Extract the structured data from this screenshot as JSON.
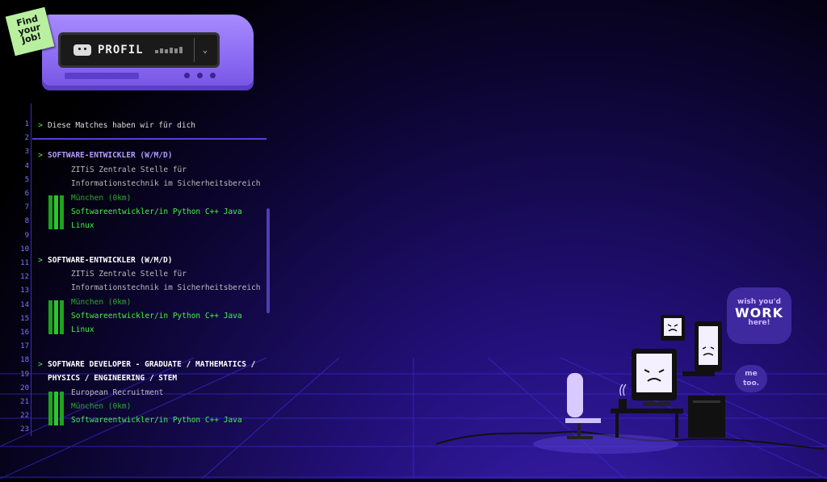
{
  "sticker": {
    "text": "Find your Job!"
  },
  "header": {
    "profile_label": "PROFIL",
    "dropdown_icon": "chevron-down-icon"
  },
  "list": {
    "line_numbers": [
      "1",
      "2",
      "3",
      "4",
      "5",
      "6",
      "7",
      "8",
      "9",
      "10",
      "11",
      "12",
      "13",
      "14",
      "15",
      "16",
      "17",
      "18",
      "19",
      "20",
      "21",
      "22",
      "23"
    ],
    "heading": "Diese Matches haben wir für dich",
    "jobs": [
      {
        "title": "SOFTWARE-ENTWICKLER (W/M/D)",
        "company1": "ZITiS Zentrale Stelle für",
        "company2": "Informationstechnik im Sicherheitsbereich",
        "location": "München (0km)",
        "tags1": "Softwareentwickler/in  Python  C++  Java",
        "tags2": "Linux"
      },
      {
        "title": "SOFTWARE-ENTWICKLER (W/M/D)",
        "company1": "ZITiS Zentrale Stelle für",
        "company2": "Informationstechnik im Sicherheitsbereich",
        "location": "München (0km)",
        "tags1": "Softwareentwickler/in  Python  C++  Java",
        "tags2": "Linux"
      },
      {
        "title1": "SOFTWARE DEVELOPER - GRADUATE / MATHEMATICS /",
        "title2": "PHYSICS / ENGINEERING / STEM",
        "company1": "European Recruitment",
        "location": "München (0km)",
        "tags1": "Softwareentwickler/in  Python  C++  Java"
      }
    ]
  },
  "scene": {
    "bubble1_line1": "wish you'd",
    "bubble1_line2": "WORK",
    "bubble1_line3": "here!",
    "bubble2_line1": "me",
    "bubble2_line2": "too."
  },
  "colors": {
    "accent": "#8a6af2",
    "match_green": "#4cf04c",
    "line_number": "#7f76ff"
  }
}
